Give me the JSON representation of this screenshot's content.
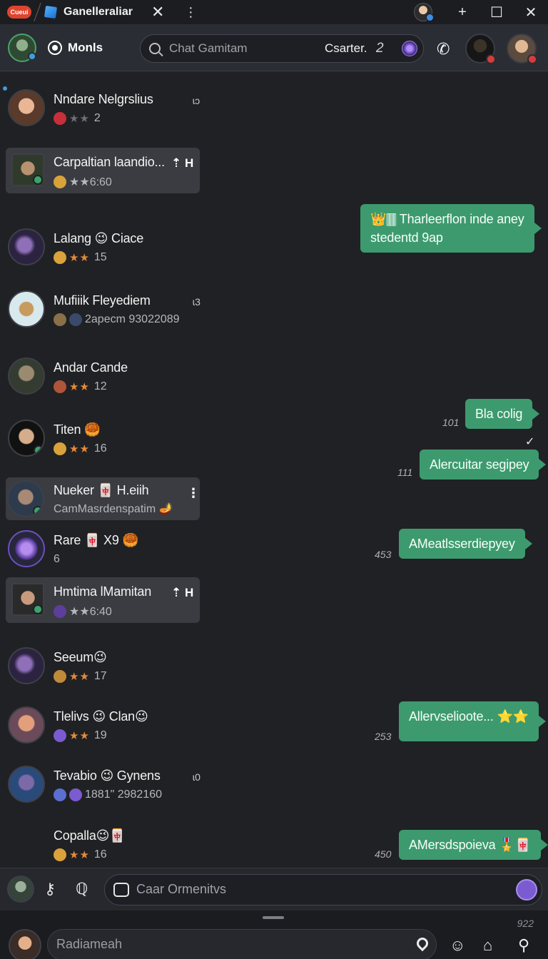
{
  "titlebar": {
    "app_badge": "Cueui",
    "tab_title": "Ganelleraliar",
    "tab_close": "✕",
    "tab_menu": "⋮",
    "new_tab": "+",
    "maximize": "☐",
    "close": "✕"
  },
  "header": {
    "brand": "Monls",
    "search_placeholder": "Chat Gamitam",
    "starter": "Csarter.",
    "count": "2",
    "phone_icon": "✆"
  },
  "contacts": [
    {
      "name": "Nndare Nelgrslius",
      "meta": "2",
      "stars": "★★",
      "stars_dim": true,
      "side": "ɩɔ",
      "icon_color": "#c7303a"
    },
    {
      "name": "Carpaltian laandio...",
      "meta": "★★6:60",
      "stars_dim": true,
      "rowicon": "⇡ H",
      "selected": true,
      "icon_color": "#d9a23a"
    },
    {
      "name": "Lalang 😉 Ciace",
      "meta": "15",
      "stars": "★★",
      "icon_color": "#d9a23a"
    },
    {
      "name": "Mufiiik Fleyediem",
      "meta": "2apecm 93022089",
      "side": "ɩ3",
      "icon_color": "#8a7048"
    },
    {
      "name": "Andar Cande",
      "meta": "12",
      "stars": "★★",
      "icon_color": "#b0543a"
    },
    {
      "name": "Titen 🥮",
      "meta": "16",
      "stars": "★★",
      "icon_color": "#d9a23a"
    },
    {
      "name": "Nueker 🀄 H.eiih",
      "meta": "CamMasrdenspatim 🪔",
      "kebab": "⋮",
      "selected": true,
      "icon_color": ""
    },
    {
      "name": "Rare 🀄 X9 🥮",
      "meta": "6",
      "icon_color": ""
    },
    {
      "name": "Hmtima lMamitan",
      "meta": "★★6:40",
      "stars_dim": true,
      "rowicon": "⇡ H",
      "selected": true,
      "icon_color": "#5b3f9a"
    },
    {
      "name": "Seeum😉",
      "meta": "17",
      "stars": "★★",
      "icon_color": "#c08a3a"
    },
    {
      "name": "Tlelivs 😉 Clan😉",
      "meta": "19",
      "stars": "★★",
      "icon_color": "#7b5bd0"
    },
    {
      "name": "Tevabio 😉 Gynens",
      "meta": "1881\" 2982160",
      "side": "ɩ0",
      "icon_color": "#5a6fd0"
    },
    {
      "name": "Copalla😉🀄",
      "meta": "16",
      "stars": "★★",
      "icon_color": "#d9a23a"
    }
  ],
  "messages": [
    {
      "text_line1": "👑🀫 Tharleerflon inde aney",
      "text_line2": "stedentd 9ap",
      "time": ""
    },
    {
      "text": "Bla colig",
      "time": "101"
    },
    {
      "text": "Alercuitar segipey",
      "time": "111",
      "tick": "✓"
    },
    {
      "text": "AMeatlsserdiepyey",
      "time": "453"
    },
    {
      "text": "Allervselioote... ⭐⭐",
      "time": "253"
    },
    {
      "text": "AMersdspoieva 🎖️🀄",
      "time": "450"
    }
  ],
  "composer": {
    "placeholder": "Caar Ormenitvs",
    "key_icon": "⚷",
    "pin_icon": "ℚ"
  },
  "bottom": {
    "placeholder": "Radiameah",
    "count": "922",
    "emoji_icon": "☺",
    "bag_icon": "⌂",
    "user_icon": "⚲"
  },
  "colors": {
    "accent_green": "#3d9a6e",
    "background": "#202124",
    "header": "#2a2d33"
  }
}
